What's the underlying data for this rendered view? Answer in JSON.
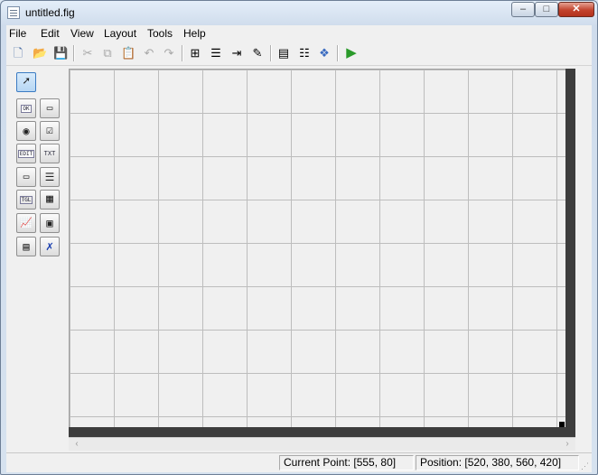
{
  "window": {
    "title": "untitled.fig",
    "controls": {
      "minimize": "–",
      "maximize": "□",
      "close": "✕"
    }
  },
  "menubar": {
    "items": [
      "File",
      "Edit",
      "View",
      "Layout",
      "Tools",
      "Help"
    ]
  },
  "toolbar": {
    "items": [
      {
        "name": "new-figure-icon",
        "glyph": "🗋",
        "enabled": true
      },
      {
        "name": "open-file-icon",
        "glyph": "📂",
        "enabled": true
      },
      {
        "name": "save-icon",
        "glyph": "💾",
        "enabled": false
      },
      {
        "name": "cut-icon",
        "glyph": "✂",
        "enabled": false
      },
      {
        "name": "copy-icon",
        "glyph": "⧉",
        "enabled": false
      },
      {
        "name": "paste-icon",
        "glyph": "📋",
        "enabled": false
      },
      {
        "name": "undo-icon",
        "glyph": "↶",
        "enabled": false
      },
      {
        "name": "redo-icon",
        "glyph": "↷",
        "enabled": false
      },
      {
        "name": "align-objects-icon",
        "glyph": "⊞",
        "enabled": true
      },
      {
        "name": "menu-editor-icon",
        "glyph": "☰",
        "enabled": true
      },
      {
        "name": "tab-order-editor-icon",
        "glyph": "⇥",
        "enabled": true
      },
      {
        "name": "toolbar-editor-icon",
        "glyph": "✎",
        "enabled": true
      },
      {
        "name": "m-file-editor-icon",
        "glyph": "▤",
        "enabled": true
      },
      {
        "name": "property-inspector-icon",
        "glyph": "☷",
        "enabled": true
      },
      {
        "name": "object-browser-icon",
        "glyph": "❖",
        "enabled": true
      },
      {
        "name": "run-figure-icon",
        "glyph": "▶",
        "enabled": true
      }
    ]
  },
  "palette": {
    "items": [
      {
        "name": "select-tool-icon",
        "text": "➚"
      },
      {
        "name": "push-button-tool-icon",
        "text": "OK"
      },
      {
        "name": "slider-tool-icon",
        "text": "▭"
      },
      {
        "name": "radio-button-tool-icon",
        "text": "◉"
      },
      {
        "name": "check-box-tool-icon",
        "text": "☑"
      },
      {
        "name": "edit-text-tool-icon",
        "text": "EDIT"
      },
      {
        "name": "static-text-tool-icon",
        "text": "TXT"
      },
      {
        "name": "popup-menu-tool-icon",
        "text": "▭"
      },
      {
        "name": "listbox-tool-icon",
        "text": "☰"
      },
      {
        "name": "toggle-button-tool-icon",
        "text": "TGL"
      },
      {
        "name": "table-tool-icon",
        "text": "▦"
      },
      {
        "name": "axes-tool-icon",
        "text": "📈"
      },
      {
        "name": "panel-tool-icon",
        "text": "▣"
      },
      {
        "name": "button-group-tool-icon",
        "text": "▤"
      },
      {
        "name": "activex-control-tool-icon",
        "text": "✗"
      }
    ]
  },
  "scrollbar": {
    "left": "‹",
    "right": "›"
  },
  "statusbar": {
    "current_point": "Current Point:  [555, 80]",
    "position": "Position: [520, 380, 560, 420]",
    "grip": "⋰"
  },
  "colors": {
    "accent": "#3b7bc3",
    "close_button": "#c2422c",
    "figure_edge": "#3d3d3d",
    "run": "#2a9a2a"
  }
}
